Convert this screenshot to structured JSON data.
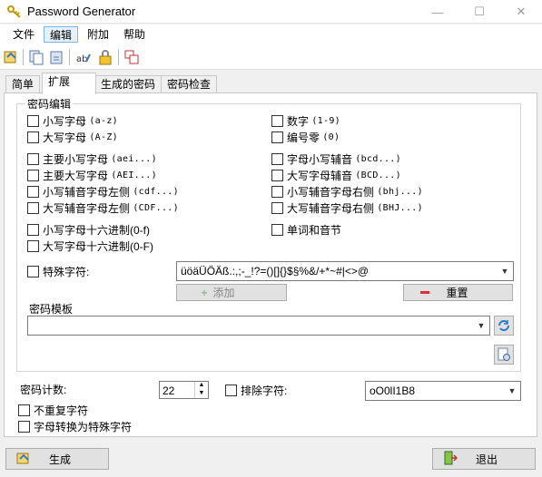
{
  "window": {
    "title": "Password Generator",
    "controls": {
      "minimize": "—",
      "maximize": "☐",
      "close": "✕"
    }
  },
  "menu": [
    "文件",
    "编辑",
    "附加",
    "帮助"
  ],
  "tabs": [
    "简单",
    "扩展",
    "生成的密码",
    "密码检查"
  ],
  "password_edit": {
    "group_title": "密码编辑",
    "left": [
      {
        "label": "小写字母",
        "hint": "(a-z)"
      },
      {
        "label": "大写字母",
        "hint": "(A-Z)"
      },
      {
        "label": "主要小写字母",
        "hint": "(aei...)"
      },
      {
        "label": "主要大写字母",
        "hint": "(AEI...)"
      },
      {
        "label": "小写辅音字母左侧",
        "hint": "(cdf...)"
      },
      {
        "label": "大写辅音字母左侧",
        "hint": "(CDF...)"
      },
      {
        "label": "小写字母十六进制(0-f)",
        "hint": ""
      },
      {
        "label": "大写字母十六进制(0-F)",
        "hint": ""
      }
    ],
    "right": [
      {
        "label": "数字",
        "hint": "(1-9)"
      },
      {
        "label": "编号零",
        "hint": "(0)"
      },
      {
        "label": "字母小写辅音",
        "hint": "(bcd...)"
      },
      {
        "label": "大写字母辅音",
        "hint": "(BCD...)"
      },
      {
        "label": "小写辅音字母右侧",
        "hint": "(bhj...)"
      },
      {
        "label": "大写辅音字母右侧",
        "hint": "(BHJ...)"
      },
      {
        "label": "单词和音节",
        "hint": ""
      }
    ],
    "special_chars": {
      "label": "特殊字符:",
      "value": "üöäÜÖÄß.:,;-_!?=()[]{}$§%&/+*~#|<>@"
    },
    "add_button": "添加",
    "reset_button": "重置",
    "template_label": "密码模板",
    "template_value": ""
  },
  "password_count": {
    "label": "密码计数:",
    "value": "22"
  },
  "exclude_chars": {
    "label": "排除字符:",
    "value": "oO0lI1B8"
  },
  "options": [
    "不重复字符",
    "字母转换为特殊字符"
  ],
  "footer": {
    "generate": "生成",
    "exit": "退出"
  },
  "colors": {
    "accent": "#7eb4ea",
    "reset_icon": "#e03030",
    "add_icon": "#3aa13a"
  }
}
